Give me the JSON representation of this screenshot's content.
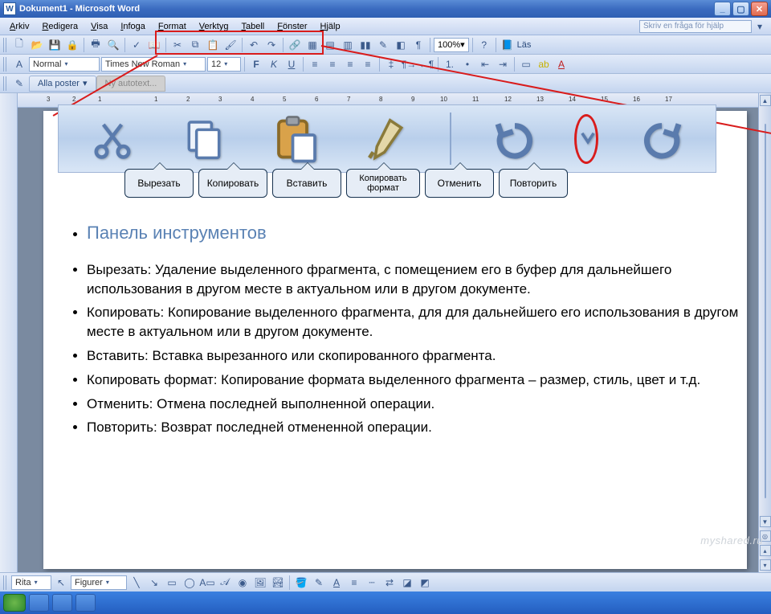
{
  "titlebar": {
    "title": "Dokument1 - Microsoft Word"
  },
  "menubar": {
    "items": [
      "Arkiv",
      "Redigera",
      "Visa",
      "Infoga",
      "Format",
      "Verktyg",
      "Tabell",
      "Fönster",
      "Hjälp"
    ],
    "ask_placeholder": "Skriv en fråga för hjälp"
  },
  "standard_toolbar": {
    "zoom": "100%",
    "lock_label": "Läs"
  },
  "formatting_toolbar": {
    "style": "Normal",
    "font": "Times New Roman",
    "size": "12"
  },
  "autotext_bar": {
    "tab1": "Alla poster",
    "tab2": "Ny autotext..."
  },
  "bottom_toolbar": {
    "rita_label": "Rita",
    "figurer_label": "Figurer"
  },
  "callouts": {
    "cut": "Вырезать",
    "copy": "Копировать",
    "paste": "Вставить",
    "formatpainter": "Копировать формат",
    "undo": "Отменить",
    "redo": "Повторить"
  },
  "doc": {
    "heading": "Панель инструментов",
    "items": [
      "Вырезать:  Удаление выделенного фрагмента, с помещением его в буфер для дальнейшего использования в другом месте в актуальном или в другом документе.",
      "Копировать: Копирование выделенного фрагмента, для для дальнейшего его использования в другом месте в актуальном или в другом документе.",
      "Вставить: Вставка вырезанного или скопированного фрагмента.",
      "Копировать формат: Копирование формата выделенного фрагмента – размер, стиль, цвет и т.д.",
      "Отменить: Отмена последней выполненной операции.",
      "Повторить: Возврат последней отмененной операции."
    ]
  },
  "watermark": "myshared.ru"
}
